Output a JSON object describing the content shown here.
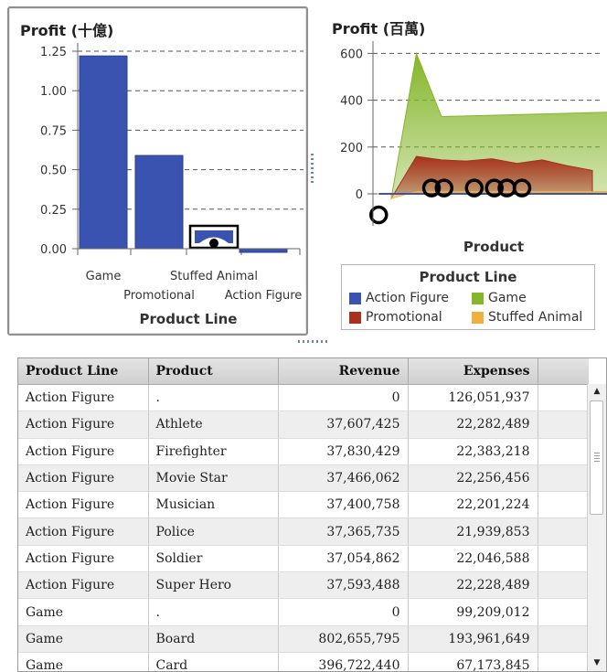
{
  "left_chart": {
    "title": "Profit (十億)",
    "xlabel": "Product Line",
    "categories_row1": [
      "Game",
      "Stuffed Animal"
    ],
    "categories_row2": [
      "Promotional",
      "Action Figure"
    ],
    "yticks": [
      "1.25",
      "1.00",
      "0.75",
      "0.50",
      "0.25",
      "0.00"
    ]
  },
  "right_chart": {
    "title": "Profit (百萬)",
    "xlabel": "Product",
    "yticks": [
      "600",
      "400",
      "200",
      "0"
    ]
  },
  "legend": {
    "title": "Product Line",
    "items": [
      {
        "label": "Action Figure",
        "color": "#3a53b0"
      },
      {
        "label": "Game",
        "color": "#84b62a"
      },
      {
        "label": "Promotional",
        "color": "#a8321e"
      },
      {
        "label": "Stuffed Animal",
        "color": "#f0b040"
      }
    ]
  },
  "chart_data": [
    {
      "type": "bar",
      "title": "Profit (十億)",
      "xlabel": "Product Line",
      "categories": [
        "Game",
        "Promotional",
        "Stuffed Animal",
        "Action Figure"
      ],
      "values": [
        1.22,
        0.59,
        0.0,
        -0.02
      ],
      "ylim": [
        -0.05,
        1.3
      ],
      "color": "#3a53b0",
      "grid": true
    },
    {
      "type": "area",
      "title": "Profit (百萬)",
      "xlabel": "Product",
      "ylim": [
        -150,
        650
      ],
      "grid": true,
      "legend": "bottom",
      "series": [
        {
          "name": "Game",
          "color": "#84b62a",
          "x": [
            1,
            2,
            3,
            10
          ],
          "values": [
            -20,
            600,
            330,
            350
          ]
        },
        {
          "name": "Promotional",
          "color": "#a8321e",
          "x": [
            1,
            2,
            3,
            4,
            5,
            6,
            7,
            8,
            9
          ],
          "values": [
            -20,
            160,
            145,
            140,
            150,
            130,
            145,
            120,
            100
          ]
        },
        {
          "name": "Stuffed Animal",
          "color": "#f0b040",
          "x": [
            1,
            2,
            3,
            10
          ],
          "values": [
            -20,
            10,
            10,
            10
          ]
        },
        {
          "name": "Action Figure",
          "color": "#3a53b0",
          "x": [
            0.5,
            11
          ],
          "values": [
            0,
            0
          ],
          "markers": [
            {
              "x": 0.5,
              "y": -90
            },
            {
              "x": 2.6,
              "y": 25
            },
            {
              "x": 3.1,
              "y": 25
            },
            {
              "x": 4.3,
              "y": 25
            },
            {
              "x": 5.1,
              "y": 25
            },
            {
              "x": 5.6,
              "y": 25
            },
            {
              "x": 6.2,
              "y": 25
            },
            {
              "x": 10.2,
              "y": 25
            }
          ]
        }
      ]
    }
  ],
  "table": {
    "columns": [
      "Product Line",
      "Product",
      "Revenue",
      "Expenses"
    ],
    "rows": [
      [
        "Action Figure",
        ".",
        "0",
        "126,051,937"
      ],
      [
        "Action Figure",
        "Athlete",
        "37,607,425",
        "22,282,489"
      ],
      [
        "Action Figure",
        "Firefighter",
        "37,830,429",
        "22,383,218"
      ],
      [
        "Action Figure",
        "Movie Star",
        "37,466,062",
        "22,256,456"
      ],
      [
        "Action Figure",
        "Musician",
        "37,400,758",
        "22,201,224"
      ],
      [
        "Action Figure",
        "Police",
        "37,365,735",
        "21,939,853"
      ],
      [
        "Action Figure",
        "Soldier",
        "37,054,862",
        "22,046,588"
      ],
      [
        "Action Figure",
        "Super Hero",
        "37,593,488",
        "22,228,489"
      ],
      [
        "Game",
        ".",
        "0",
        "99,209,012"
      ],
      [
        "Game",
        "Board",
        "802,655,795",
        "193,961,649"
      ],
      [
        "Game",
        "Card",
        "396,722,440",
        "67,173,845"
      ]
    ]
  }
}
